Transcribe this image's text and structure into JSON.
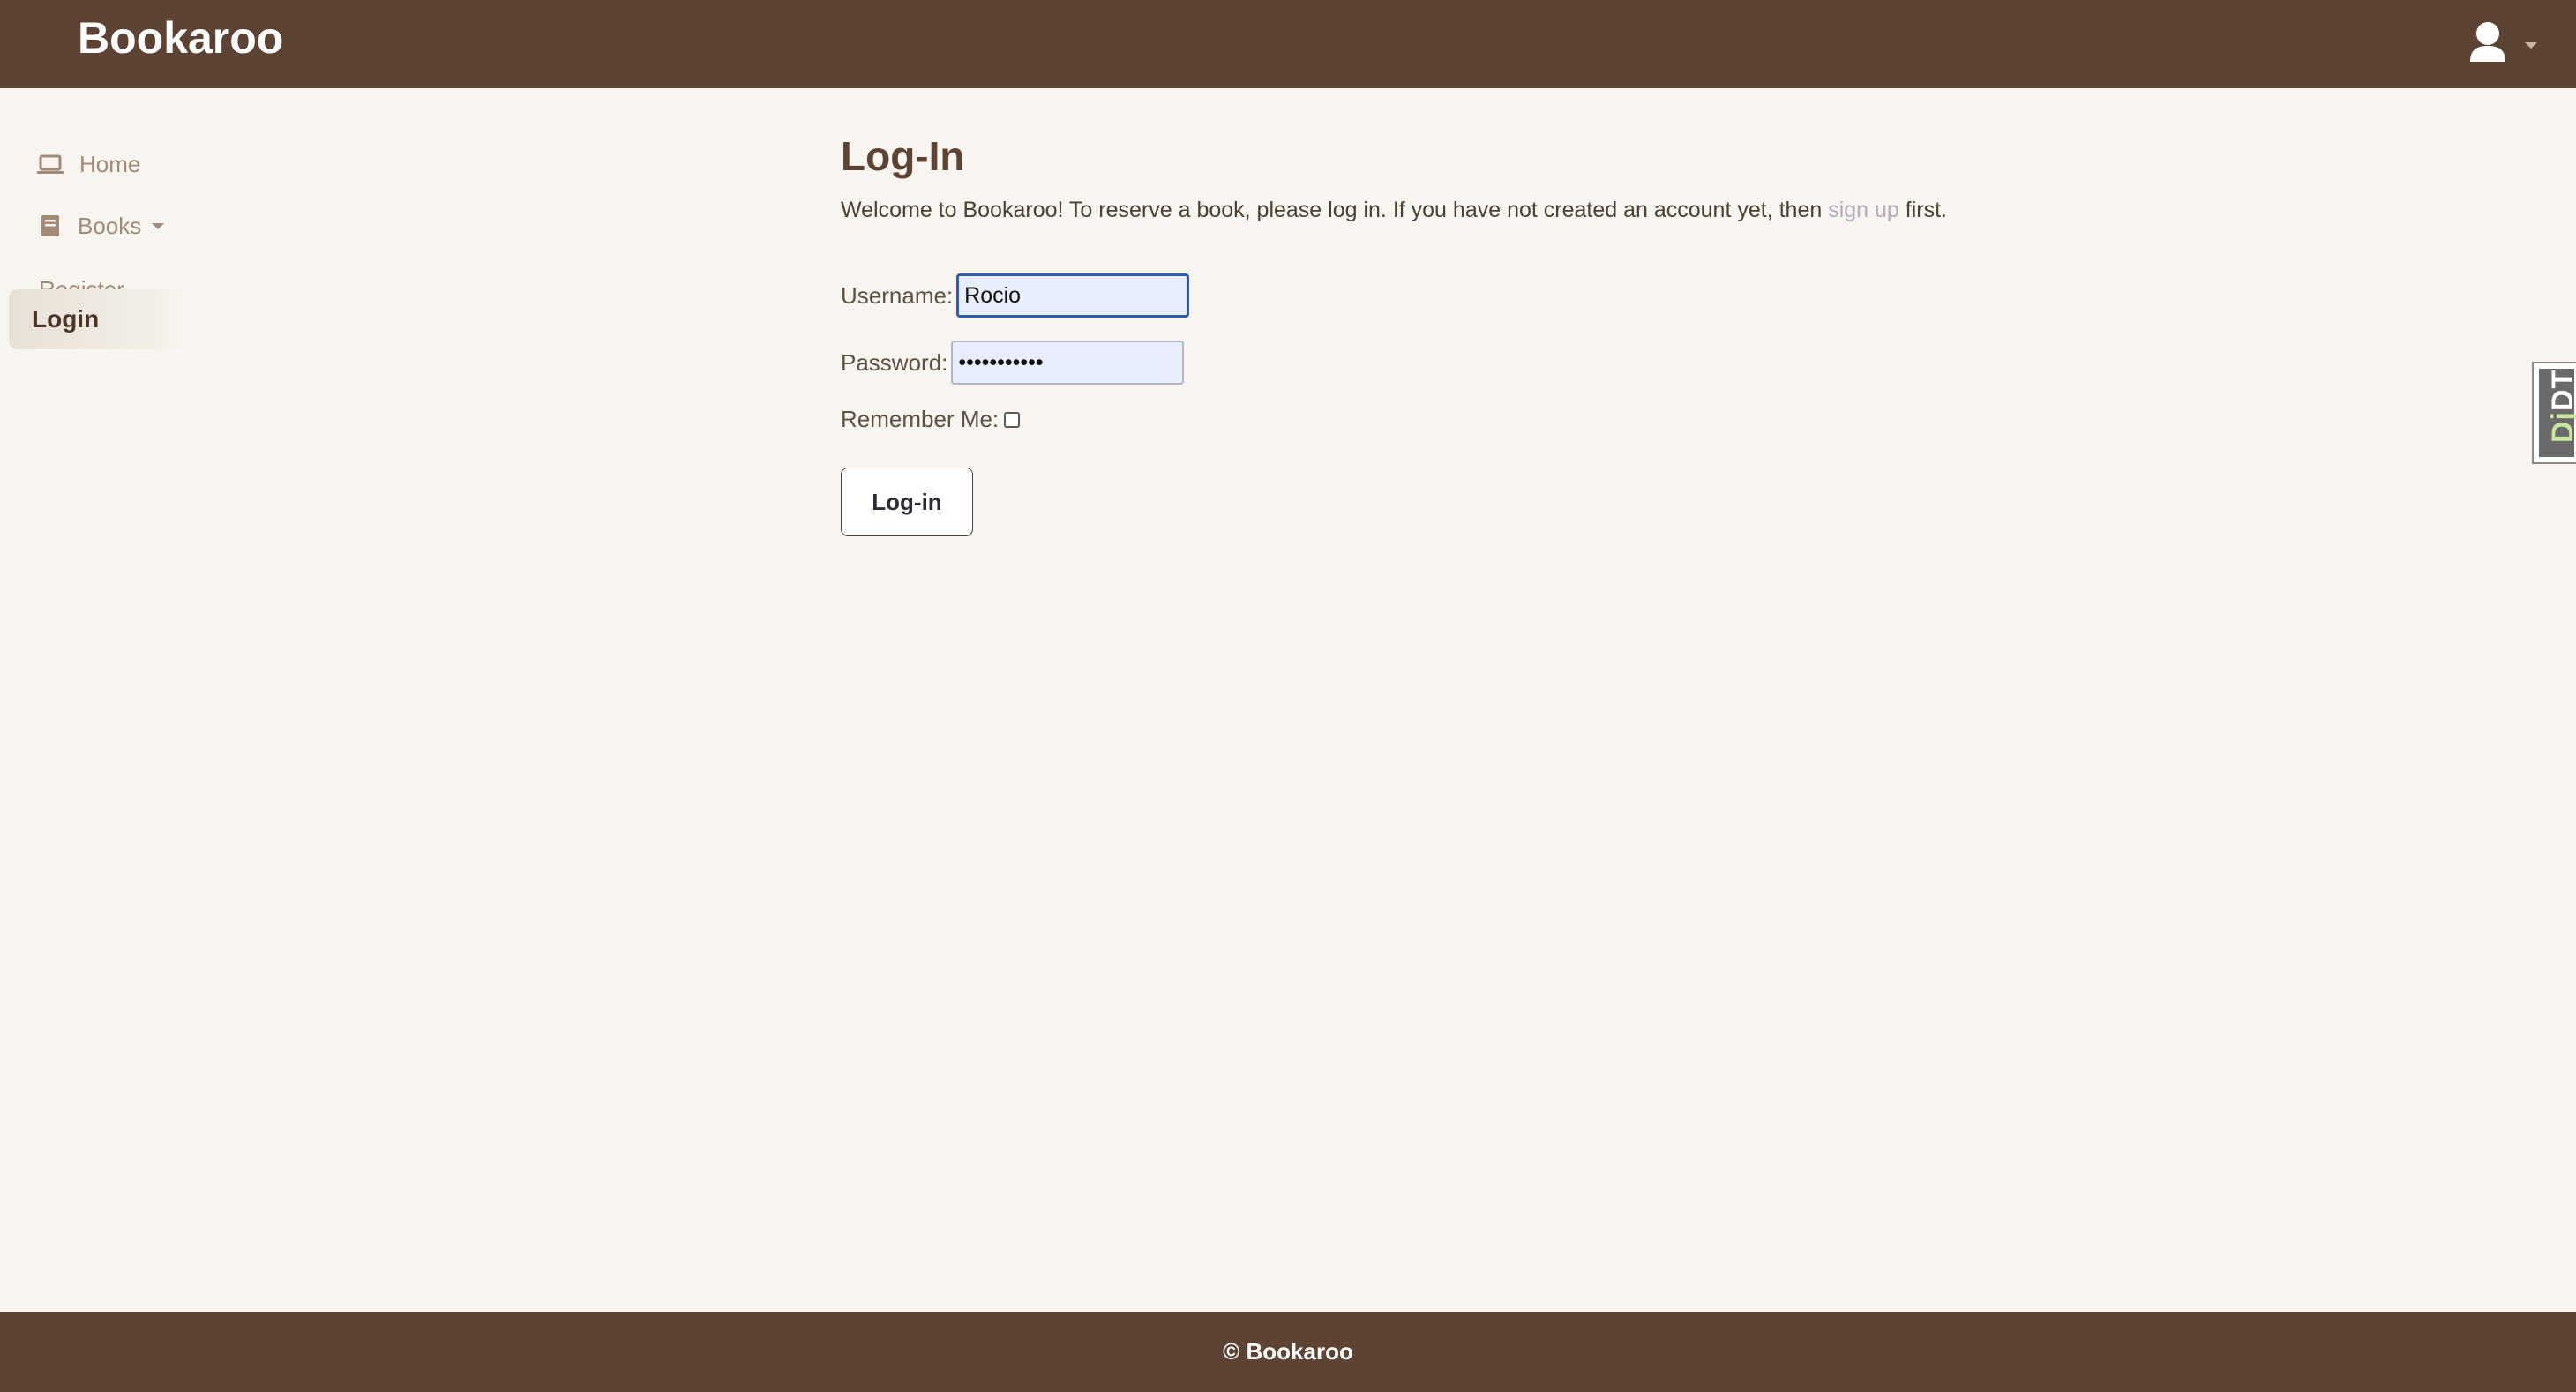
{
  "header": {
    "brand": "Bookaroo",
    "user_icon": "user-icon"
  },
  "sidebar": {
    "items": [
      {
        "label": "Home",
        "icon": "laptop-icon"
      },
      {
        "label": "Books",
        "icon": "book-icon"
      },
      {
        "label": "Register"
      },
      {
        "label": "Login",
        "active": true
      }
    ]
  },
  "main": {
    "title": "Log-In",
    "intro_before": "Welcome to Bookaroo! To reserve a book, please log in. If you have not created an account yet, then ",
    "intro_link": "sign up",
    "intro_after": " first.",
    "username_label": "Username:",
    "username_value": "Rocio",
    "password_label": "Password:",
    "password_value": "•••••••••••",
    "remember_label": "Remember Me:",
    "remember_checked": false,
    "submit_label": "Log-in"
  },
  "debug_toolbar": {
    "label_dj": "Dj",
    "label_dt": "DT"
  },
  "footer": {
    "text": "© Bookaroo"
  },
  "colors": {
    "header_bg": "#5d4333",
    "page_bg": "#f8f5f0",
    "link": "#b8aab8"
  }
}
